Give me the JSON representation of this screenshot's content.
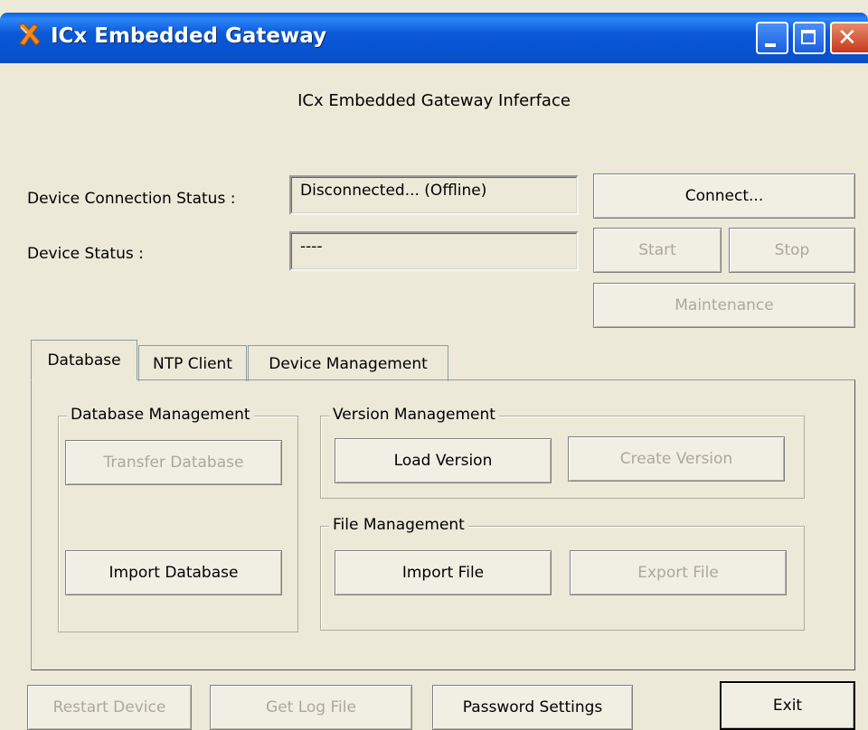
{
  "window": {
    "title": "ICx Embedded Gateway",
    "icon": "x-logo-icon",
    "controls": [
      "minimize-icon",
      "maximize-icon",
      "close-icon"
    ]
  },
  "header": {
    "text": "ICx Embedded Gateway Inferface"
  },
  "status": {
    "connection_label": "Device Connection Status :",
    "connection_value": "Disconnected... (Offline)",
    "device_label": "Device Status :",
    "device_value": "----"
  },
  "controls": {
    "connect": "Connect...",
    "start": "Start",
    "stop": "Stop",
    "maintenance": "Maintenance"
  },
  "tabs": [
    {
      "label": "Database",
      "active": true
    },
    {
      "label": "NTP Client",
      "active": false
    },
    {
      "label": "Device Management",
      "active": false
    }
  ],
  "database_tab": {
    "db_management": {
      "title": "Database Management",
      "transfer": "Transfer Database",
      "import": "Import Database"
    },
    "version_management": {
      "title": "Version Management",
      "load": "Load Version",
      "create": "Create Version"
    },
    "file_management": {
      "title": "File Management",
      "import": "Import File",
      "export": "Export File"
    }
  },
  "footer": {
    "restart": "Restart Device",
    "log": "Get Log File",
    "password": "Password Settings",
    "exit": "Exit"
  },
  "colors": {
    "titlebar": "#0c5ad8",
    "window_bg": "#ece9d8",
    "disabled_text": "#aca899"
  }
}
